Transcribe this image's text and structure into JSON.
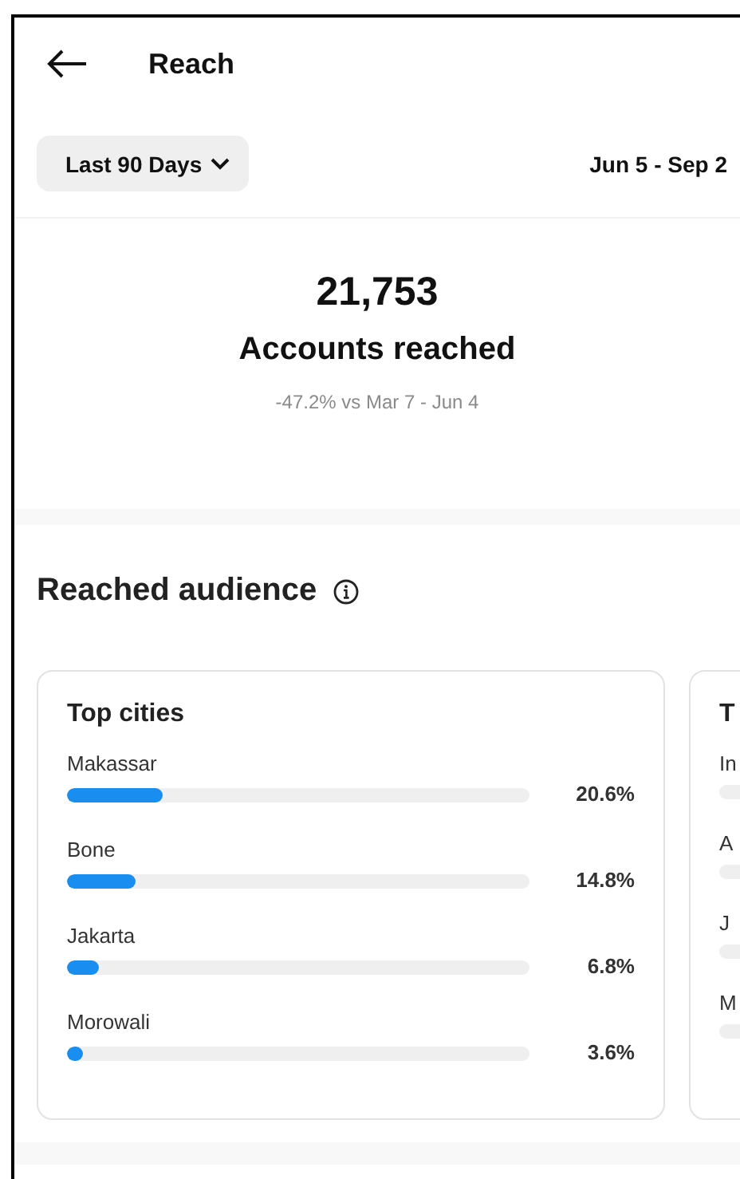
{
  "header": {
    "title": "Reach"
  },
  "filter": {
    "label": "Last 90 Days",
    "date_range": "Jun 5 - Sep 2"
  },
  "summary": {
    "value": "21,753",
    "label": "Accounts reached",
    "comparison": "-47.2% vs Mar 7 - Jun 4"
  },
  "audience": {
    "title": "Reached audience",
    "cards": [
      {
        "title": "Top cities",
        "rows": [
          {
            "name": "Makassar",
            "level": 0.206,
            "value": "20.6%"
          },
          {
            "name": "Bone",
            "level": 0.148,
            "value": "14.8%"
          },
          {
            "name": "Jakarta",
            "level": 0.068,
            "value": "6.8%"
          },
          {
            "name": "Morowali",
            "level": 0.036,
            "value": "3.6%"
          }
        ]
      },
      {
        "title": "T",
        "rows": [
          {
            "name": "In"
          },
          {
            "name": "A"
          },
          {
            "name": "J"
          },
          {
            "name": "M"
          }
        ]
      }
    ]
  }
}
